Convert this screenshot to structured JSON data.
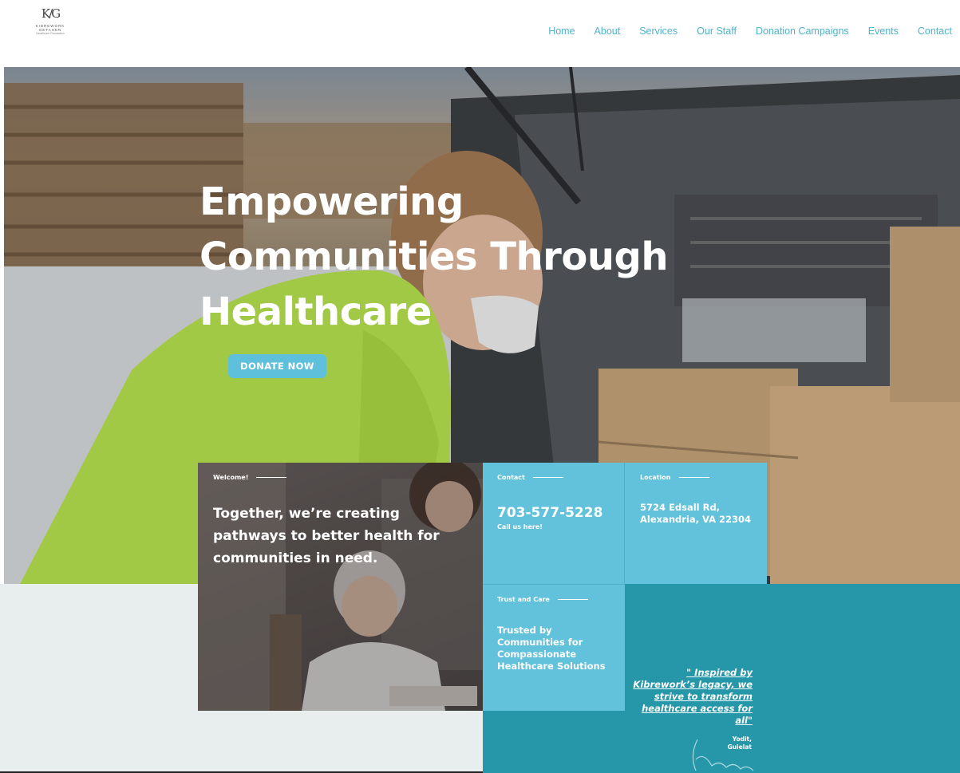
{
  "logo": {
    "mark": "K/G",
    "line1": "KIBREWORK",
    "line2": "GETAHEN",
    "line3": "Healthcare Foundation"
  },
  "nav": {
    "items": [
      "Home",
      "About",
      "Services",
      "Our Staff",
      "Donation Campaigns",
      "Events",
      "Contact"
    ]
  },
  "hero": {
    "title_lines": [
      "Empowering",
      "Communities Through",
      "Healthcare"
    ],
    "donate_label": "DONATE NOW"
  },
  "welcome": {
    "label": "Welcome!",
    "text": "Together, we’re creating pathways to better health for communities in need."
  },
  "contact": {
    "label": "Contact",
    "phone": "703-577-5228",
    "sub": "Call us here!"
  },
  "location": {
    "label": "Location",
    "address": "5724 Edsall Rd, Alexandria, VA 22304"
  },
  "trust": {
    "label": "Trust and Care",
    "text": "Trusted by Communities for Compassionate Healthcare Solutions"
  },
  "quote": {
    "text": "\" Inspired by Kibrework’s legacy, we strive to transform healthcare access for all\"",
    "author_line1": "Yodit,",
    "author_line2": "Guielat"
  },
  "colors": {
    "accent": "#62c1db",
    "teal": "#2697a9",
    "nav": "#4fb3cc",
    "lower_bg": "#e8eded"
  }
}
